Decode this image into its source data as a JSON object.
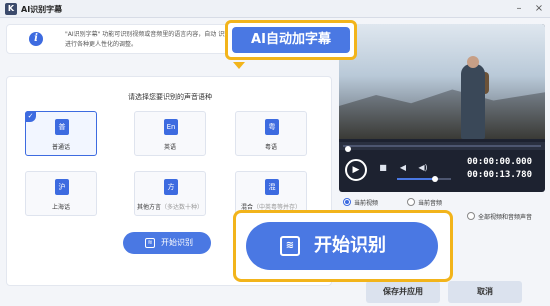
{
  "window": {
    "title": "AI识别字幕",
    "logo_icon": "app-logo-icon",
    "minimize_glyph": "–",
    "close_glyph": "×"
  },
  "info": {
    "text": "\"AI识别字幕\" 功能可识别视频或音频里的语言内容，自动 识别结果进行各种更人性化的调整。"
  },
  "languages": {
    "prompt": "请选择您要识别的声音语种",
    "items": [
      {
        "glyph": "普",
        "label": "普通话",
        "sub": "",
        "selected": true
      },
      {
        "glyph": "En",
        "label": "英语",
        "sub": "",
        "selected": false
      },
      {
        "glyph": "粤",
        "label": "粤语",
        "sub": "",
        "selected": false
      },
      {
        "glyph": "沪",
        "label": "上海话",
        "sub": "",
        "selected": false
      },
      {
        "glyph": "方",
        "label": "其他方言",
        "sub": "（多达数十种）",
        "selected": false
      },
      {
        "glyph": "混",
        "label": "混合",
        "sub": "（中英粤等并存）",
        "selected": false
      }
    ],
    "check_glyph": "✓"
  },
  "start_small": {
    "label": "开始识别",
    "icon": "waveform-icon"
  },
  "callout_top": {
    "label": "AI自动加字幕"
  },
  "callout_big": {
    "label": "开始识别",
    "icon": "waveform-icon"
  },
  "player": {
    "play_glyph": "▶",
    "stop_glyph": "■",
    "rewind_glyph": "◀",
    "volume_glyph": "◀)",
    "volume_level": 0.7,
    "time_current": "00:00:00.000",
    "time_total": "00:00:13.780"
  },
  "radios": [
    {
      "label": "当前视频",
      "checked": true
    },
    {
      "label": "当前音频",
      "checked": false
    },
    {
      "label": "全部视频和音频声音",
      "checked": false
    }
  ],
  "footer": {
    "apply_label": "保存并应用",
    "cancel_label": "取消"
  }
}
